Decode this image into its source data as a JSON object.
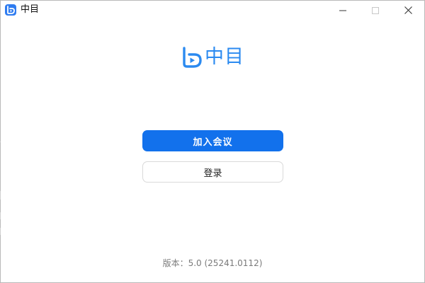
{
  "window": {
    "title": "中目"
  },
  "titlebar_buttons": {
    "minimize_icon": "minimize-icon",
    "maximize_icon": "maximize-icon",
    "close_icon": "close-icon"
  },
  "logo": {
    "text": "中目",
    "icon": "app-logo-icon",
    "color": "#2b8af0"
  },
  "actions": {
    "join_meeting": "加入会议",
    "login": "登录"
  },
  "footer": {
    "version": "版本：5.0 (25241.0112)"
  },
  "colors": {
    "primary_button": "#1271ec",
    "brand": "#2b8af0"
  }
}
